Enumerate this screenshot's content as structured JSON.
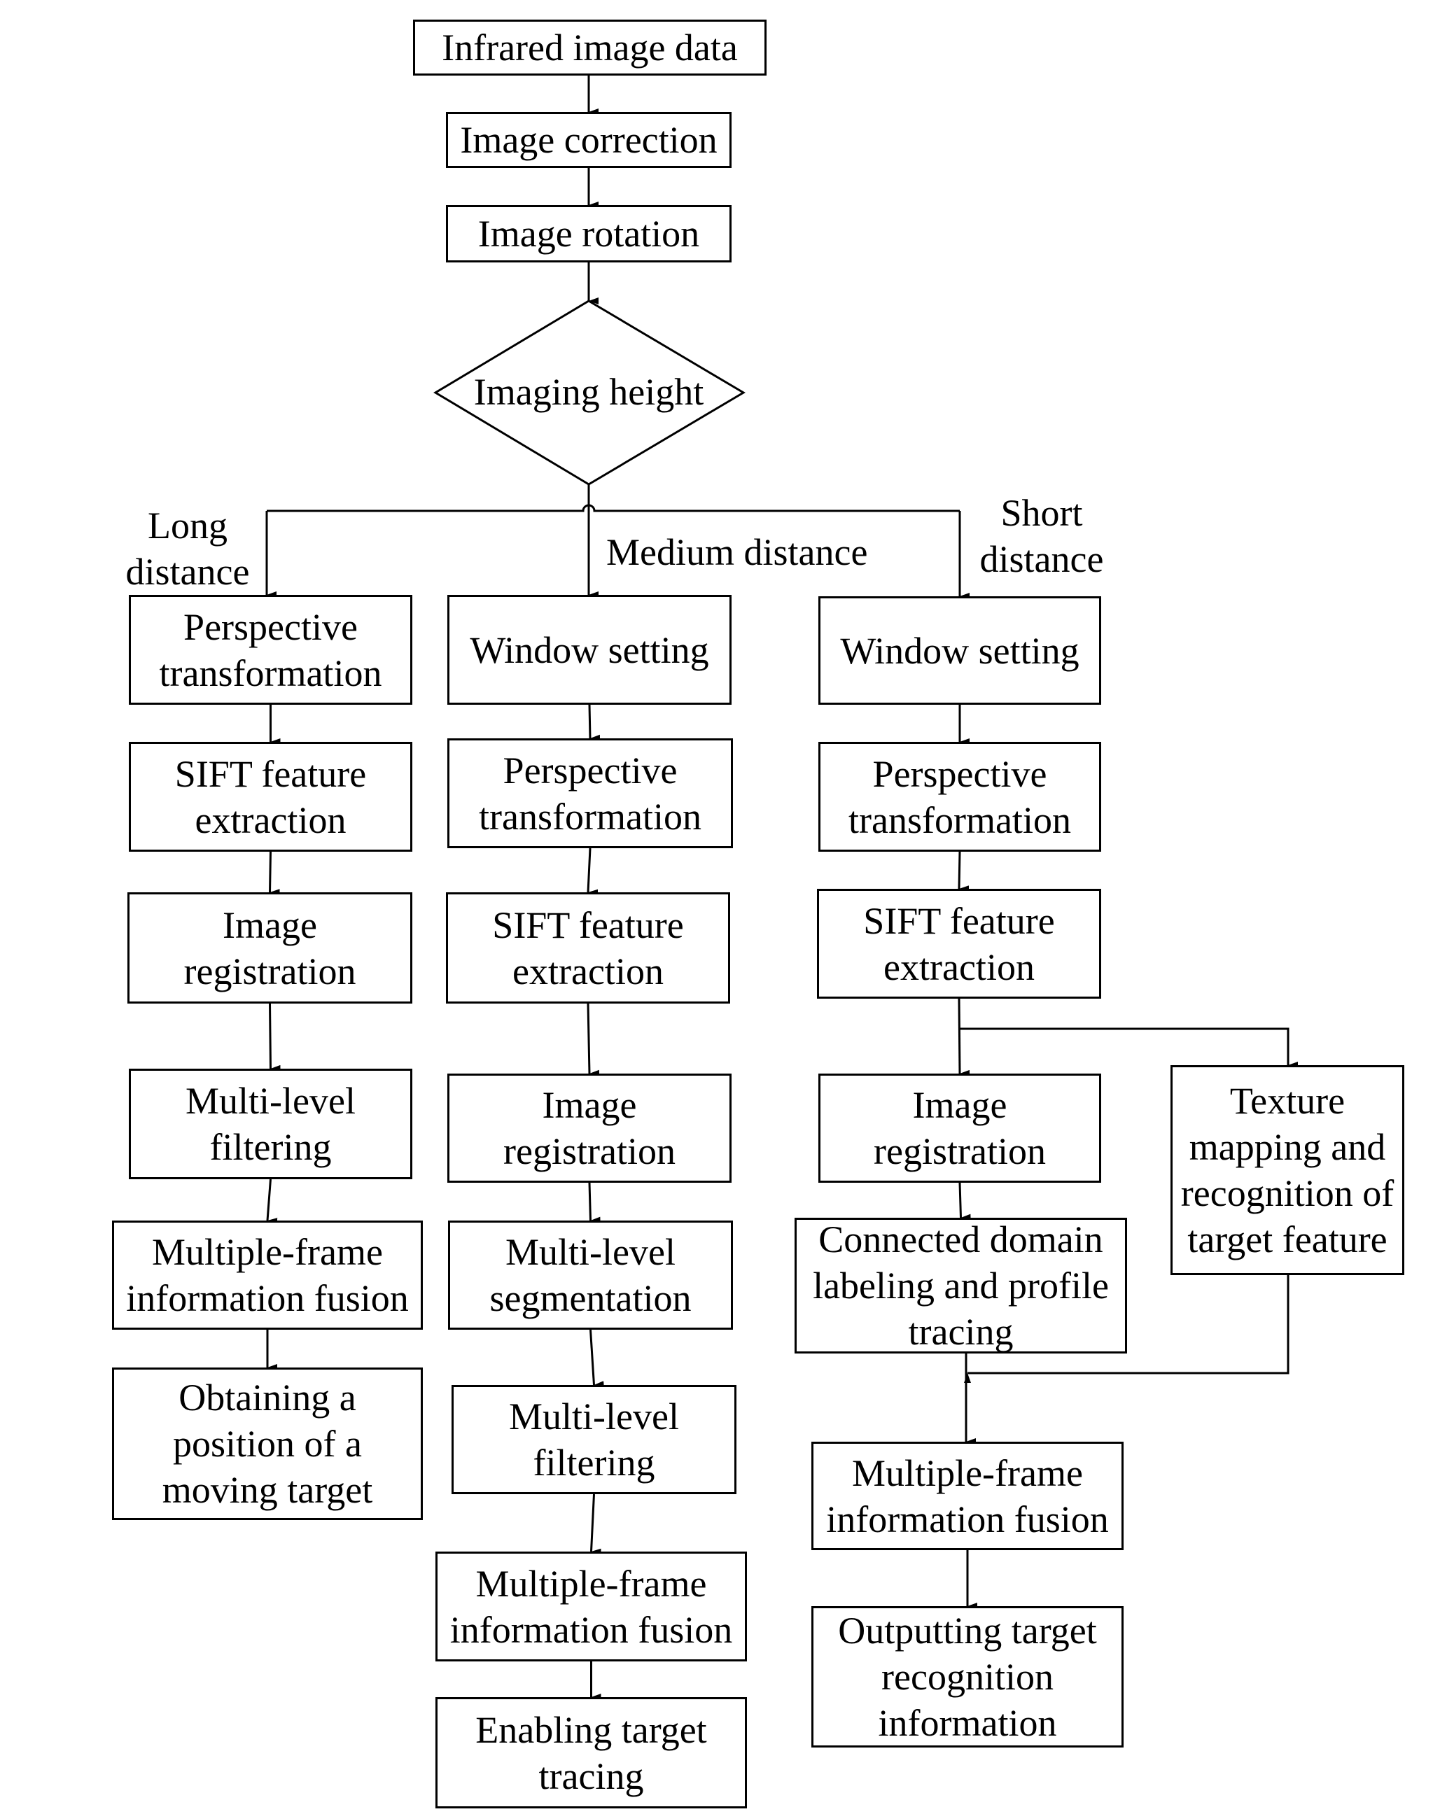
{
  "diagram": {
    "start": "Infrared image data",
    "steps_common": [
      "Image correction",
      "Image rotation"
    ],
    "decision": "Imaging height",
    "branch_labels": {
      "long": [
        "Long",
        "distance"
      ],
      "medium": "Medium distance",
      "short": [
        "Short",
        "distance"
      ]
    },
    "long_branch": [
      [
        "Perspective",
        "transformation"
      ],
      [
        "SIFT feature",
        "extraction"
      ],
      [
        "Image",
        "registration"
      ],
      [
        "Multi-level",
        "filtering"
      ],
      [
        "Multiple-frame",
        "information fusion"
      ],
      [
        "Obtaining a",
        "position of a",
        "moving target"
      ]
    ],
    "medium_branch": [
      [
        "Window setting"
      ],
      [
        "Perspective",
        "transformation"
      ],
      [
        "SIFT feature",
        "extraction"
      ],
      [
        "Image",
        "registration"
      ],
      [
        "Multi-level",
        "segmentation"
      ],
      [
        "Multi-level",
        "filtering"
      ],
      [
        "Multiple-frame",
        "information fusion"
      ],
      [
        "Enabling target",
        "tracing"
      ]
    ],
    "short_branch": [
      [
        "Window setting"
      ],
      [
        "Perspective",
        "transformation"
      ],
      [
        "SIFT feature",
        "extraction"
      ],
      [
        "Image",
        "registration"
      ],
      [
        "Connected domain",
        "labeling and profile",
        "tracing"
      ],
      [
        "Multiple-frame",
        "information fusion"
      ],
      [
        "Outputting target",
        "recognition",
        "information"
      ]
    ],
    "short_side_branch": [
      "Texture",
      "mapping and",
      "recognition of",
      "target feature"
    ]
  }
}
